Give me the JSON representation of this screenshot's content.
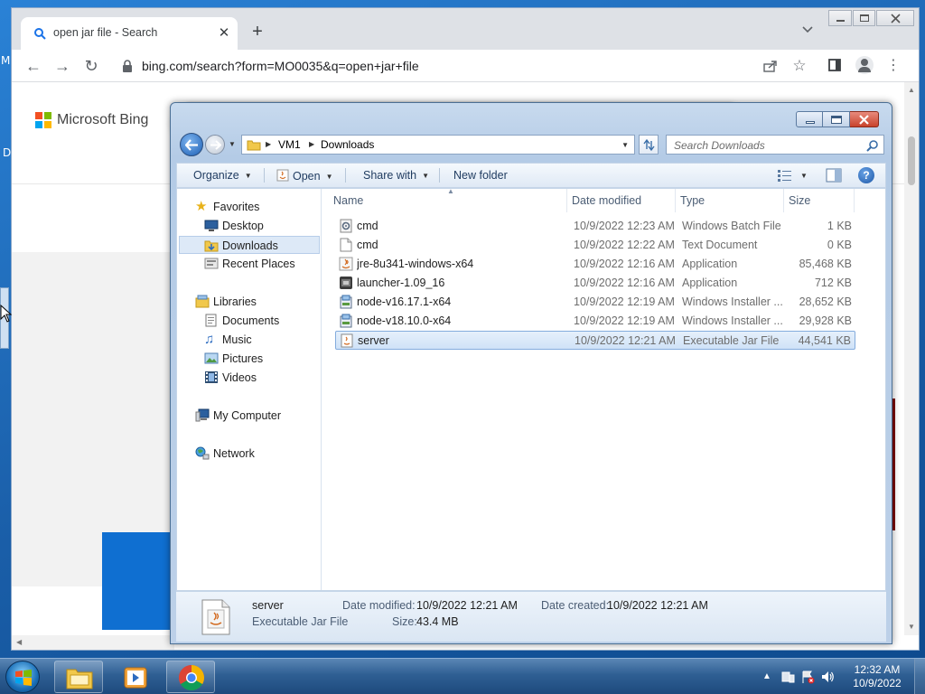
{
  "desktop": {
    "fragment_left_top": "M",
    "fragment_left_mid": "D"
  },
  "chrome": {
    "tab_title": "open jar file - Search",
    "tab_close": "✕",
    "new_tab": "+",
    "url": "bing.com/search?form=MO0035&q=open+jar+file",
    "bing_brand": "Microsoft Bing",
    "ms_colors": [
      "#f25022",
      "#7fba00",
      "#00a4ef",
      "#ffb900"
    ]
  },
  "explorer": {
    "breadcrumb": [
      "VM1",
      "Downloads"
    ],
    "search_placeholder": "Search Downloads",
    "commands": {
      "organize": "Organize",
      "open": "Open",
      "share_with": "Share with",
      "new_folder": "New folder"
    },
    "nav": {
      "favorites": "Favorites",
      "desktop": "Desktop",
      "downloads": "Downloads",
      "recent_places": "Recent Places",
      "libraries": "Libraries",
      "documents": "Documents",
      "music": "Music",
      "pictures": "Pictures",
      "videos": "Videos",
      "my_computer": "My Computer",
      "network": "Network"
    },
    "columns": {
      "name": "Name",
      "date_modified": "Date modified",
      "type": "Type",
      "size": "Size"
    },
    "files": [
      {
        "name": "cmd",
        "date": "10/9/2022 12:23 AM",
        "type": "Windows Batch File",
        "size": "1 KB",
        "icon": "batch-file-icon"
      },
      {
        "name": "cmd",
        "date": "10/9/2022 12:22 AM",
        "type": "Text Document",
        "size": "0 KB",
        "icon": "text-file-icon"
      },
      {
        "name": "jre-8u341-windows-x64",
        "date": "10/9/2022 12:16 AM",
        "type": "Application",
        "size": "85,468 KB",
        "icon": "java-installer-icon"
      },
      {
        "name": "launcher-1.09_16",
        "date": "10/9/2022 12:16 AM",
        "type": "Application",
        "size": "712 KB",
        "icon": "launcher-app-icon"
      },
      {
        "name": "node-v16.17.1-x64",
        "date": "10/9/2022 12:19 AM",
        "type": "Windows Installer ...",
        "size": "28,652 KB",
        "icon": "msi-installer-icon"
      },
      {
        "name": "node-v18.10.0-x64",
        "date": "10/9/2022 12:19 AM",
        "type": "Windows Installer ...",
        "size": "29,928 KB",
        "icon": "msi-installer-icon"
      },
      {
        "name": "server",
        "date": "10/9/2022 12:21 AM",
        "type": "Executable Jar File",
        "size": "44,541 KB",
        "icon": "jar-file-icon",
        "selected": true
      }
    ],
    "details": {
      "name": "server",
      "type": "Executable Jar File",
      "date_modified_label": "Date modified:",
      "date_modified": "10/9/2022 12:21 AM",
      "date_created_label": "Date created:",
      "date_created": "10/9/2022 12:21 AM",
      "size_label": "Size:",
      "size": "43.4 MB"
    }
  },
  "taskbar": {
    "time": "12:32 AM",
    "date": "10/9/2022"
  }
}
